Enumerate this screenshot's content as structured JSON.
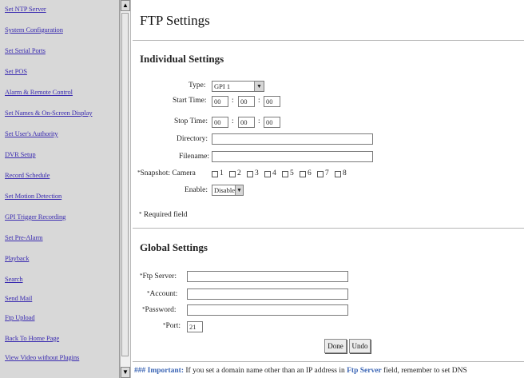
{
  "sidebar": {
    "items": [
      "Set NTP Server",
      "System Configuration",
      "Set Serial Ports",
      "Set POS",
      "Alarm & Remote Control",
      "Set Names & On-Screen Display",
      "Set User's Authority",
      "DVR Setup",
      "Record Schedule",
      "Set Motion Detection",
      "GPI Trigger Recording",
      "Set Pre-Alarm",
      "Playback",
      "Search",
      "Send Mail",
      "Ftp Upload",
      "Back To Home Page",
      "View Video without Plugins"
    ]
  },
  "scroll": {
    "up": "▲",
    "down": "▼"
  },
  "page": {
    "title": "FTP Settings",
    "individual": {
      "heading": "Individual Settings",
      "type_label": "Type:",
      "type_value": "GPI 1",
      "start_label": "Start Time:",
      "start": [
        "00",
        "00",
        "00"
      ],
      "stop_label": "Stop Time:",
      "stop": [
        "00",
        "00",
        "00"
      ],
      "directory_label": "Directory:",
      "directory_value": "",
      "filename_label": "Filename:",
      "filename_value": "",
      "snapshot_label": "Snapshot: Camera",
      "cameras": [
        "1",
        "2",
        "3",
        "4",
        "5",
        "6",
        "7",
        "8"
      ],
      "enable_label": "Enable:",
      "enable_value": "Disable",
      "required_note": "Required field",
      "star": "*"
    },
    "global": {
      "heading": "Global Settings",
      "ftp_label": "Ftp Server:",
      "ftp_value": "",
      "account_label": "Account:",
      "account_value": "",
      "password_label": "Password:",
      "password_value": "",
      "port_label": "Port:",
      "port_value": "21"
    },
    "buttons": {
      "done": "Done",
      "undo": "Undo"
    },
    "note": {
      "lead": "### Important:",
      "text1": " If you set a domain name other than an IP address in ",
      "highlight": "Ftp Server",
      "text2": " field, remember to set DNS"
    }
  }
}
